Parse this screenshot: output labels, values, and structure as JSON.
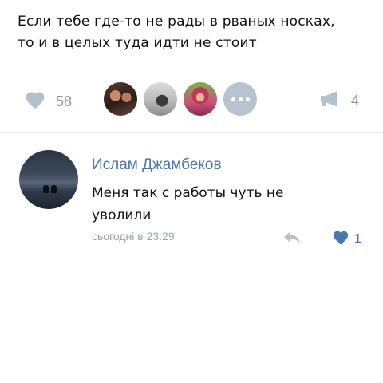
{
  "post": {
    "text_lines": [
      "Если тебе где-то не рады в рваных носках,",
      "то и в целых туда идти не стоит"
    ],
    "likes_count": "58",
    "shares_count": "4",
    "likers": [
      {
        "icon": "avatar-photo"
      },
      {
        "icon": "avatar-photo"
      },
      {
        "icon": "avatar-photo"
      }
    ],
    "more_icon": "ellipsis-icon"
  },
  "comment": {
    "author": "Ислам Джамбеков",
    "text": "Меня так с работы чуть не уволили",
    "time": "сьогодні в 23:29",
    "likes_count": "1"
  },
  "colors": {
    "link_blue": "#4a76a8",
    "muted_gray": "#8f9aa6",
    "liked_heart": "#4a76a8",
    "more_circle": "#b8c3cf"
  }
}
